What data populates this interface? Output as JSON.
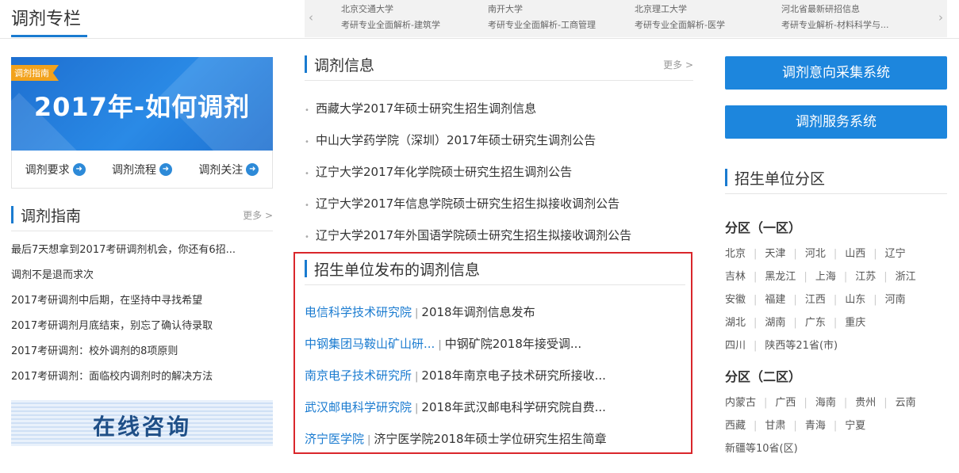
{
  "header": {
    "title": "调剂专栏"
  },
  "carousel": {
    "items": [
      {
        "line1": "北京交通大学",
        "line2": "考研专业全面解析-建筑学"
      },
      {
        "line1": "南开大学",
        "line2": "考研专业全面解析-工商管理"
      },
      {
        "line1": "北京理工大学",
        "line2": "考研专业全面解析-医学"
      },
      {
        "line1": "河北省最新研招信息",
        "line2": "考研专业解析-材料科学与..."
      }
    ],
    "prev_icon": "‹",
    "next_icon": "›"
  },
  "banner": {
    "tag": "调剂指南",
    "title": "2017年-如何调剂",
    "links": [
      "调剂要求",
      "调剂流程",
      "调剂关注"
    ],
    "link_icon": "➜"
  },
  "guide": {
    "title": "调剂指南",
    "more": "更多 >",
    "items": [
      "最后7天想拿到2017考研调剂机会，你还有6招...",
      "调剂不是退而求次",
      "2017考研调剂中后期，在坚持中寻找希望",
      "2017考研调剂月底结束，别忘了确认待录取",
      "2017考研调剂：校外调剂的8项原则",
      "2017考研调剂：面临校内调剂时的解决方法"
    ],
    "consult": "在线咨询"
  },
  "info": {
    "title": "调剂信息",
    "more": "更多 >",
    "items": [
      "西藏大学2017年硕士研究生招生调剂信息",
      "中山大学药学院（深圳）2017年硕士研究生调剂公告",
      "辽宁大学2017年化学院硕士研究生招生调剂公告",
      "辽宁大学2017年信息学院硕士研究生招生拟接收调剂公告",
      "辽宁大学2017年外国语学院硕士研究生招生拟接收调剂公告"
    ]
  },
  "units": {
    "title": "招生单位发布的调剂信息",
    "separator": "|",
    "items": [
      {
        "name": "电信科学技术研究院",
        "desc": "2018年调剂信息发布"
      },
      {
        "name": "中钢集团马鞍山矿山研...",
        "desc": "中钢矿院2018年接受调..."
      },
      {
        "name": "南京电子技术研究所",
        "desc": "2018年南京电子技术研究所接收..."
      },
      {
        "name": "武汉邮电科学研究院",
        "desc": "2018年武汉邮电科学研究院自费..."
      },
      {
        "name": "济宁医学院",
        "desc": "济宁医学院2018年硕士学位研究生招生简章"
      }
    ]
  },
  "systems": {
    "collect": "调剂意向采集系统",
    "service": "调剂服务系统"
  },
  "regions": {
    "title": "招生单位分区",
    "zone1": {
      "title": "分区（一区）",
      "rows": [
        [
          "北京",
          "天津",
          "河北",
          "山西",
          "辽宁"
        ],
        [
          "吉林",
          "黑龙江",
          "上海",
          "江苏",
          "浙江"
        ],
        [
          "安徽",
          "福建",
          "江西",
          "山东",
          "河南"
        ],
        [
          "湖北",
          "湖南",
          "广东",
          "重庆"
        ],
        [
          "四川",
          "陕西等21省(市)"
        ]
      ]
    },
    "zone2": {
      "title": "分区（二区）",
      "rows": [
        [
          "内蒙古",
          "广西",
          "海南",
          "贵州",
          "云南"
        ],
        [
          "西藏",
          "甘肃",
          "青海",
          "宁夏"
        ],
        [
          "新疆等10省(区)"
        ]
      ]
    }
  },
  "colors": {
    "accent": "#1a7bd0",
    "highlight_border": "#d9262b",
    "button": "#1d86dd"
  }
}
